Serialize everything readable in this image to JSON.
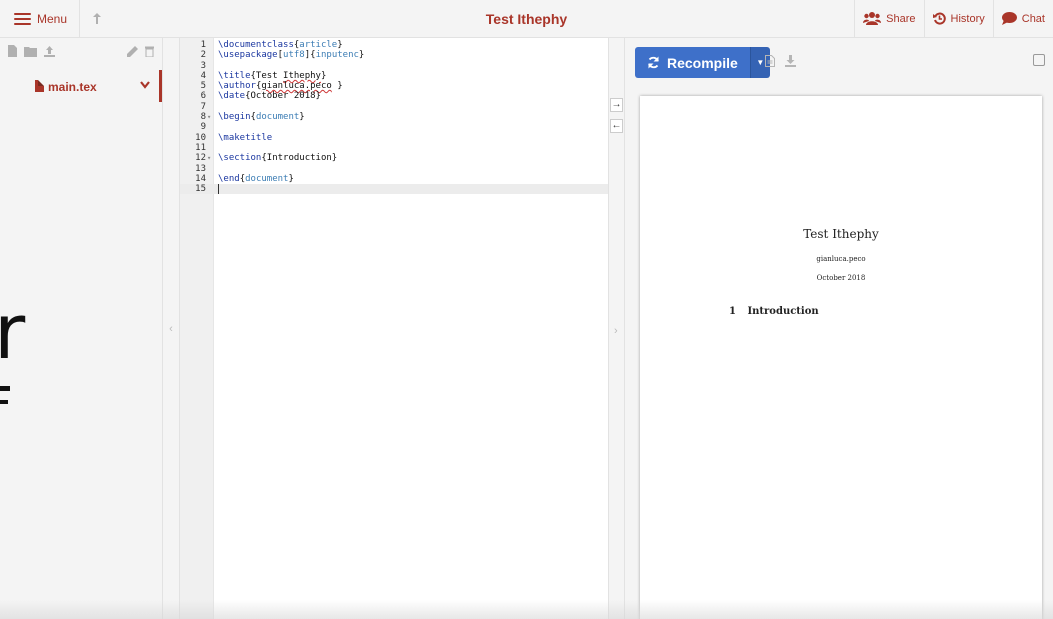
{
  "toolbar": {
    "menu_label": "Menu",
    "title": "Test Ithephy",
    "share_label": "Share",
    "history_label": "History",
    "chat_label": "Chat"
  },
  "colors": {
    "accent": "#a93529",
    "recompile": "#3e70c9"
  },
  "filetree": {
    "files": [
      {
        "name": "main.tex",
        "selected": true
      }
    ]
  },
  "editor": {
    "lines": [
      {
        "n": "1",
        "cmd": "\\documentclass",
        "args": [
          [
            "{",
            ""
          ],
          [
            "article",
            "arg"
          ],
          [
            "}",
            ""
          ]
        ]
      },
      {
        "n": "2",
        "cmd": "\\usepackage",
        "args": [
          [
            "[",
            ""
          ],
          [
            "utf8",
            "arg"
          ],
          [
            "]{",
            ""
          ],
          [
            "inputenc",
            "arg"
          ],
          [
            "}",
            ""
          ]
        ]
      },
      {
        "n": "3"
      },
      {
        "n": "4",
        "cmd": "\\title",
        "args": [
          [
            "{Test ",
            ""
          ],
          [
            "Ithephy",
            "squig"
          ],
          [
            "}",
            ""
          ]
        ]
      },
      {
        "n": "5",
        "cmd": "\\author",
        "args": [
          [
            "{",
            ""
          ],
          [
            "gianluca.peco",
            "squig"
          ],
          [
            " }",
            ""
          ]
        ]
      },
      {
        "n": "6",
        "cmd": "\\date",
        "args": [
          [
            "{October 2018}",
            ""
          ]
        ]
      },
      {
        "n": "7"
      },
      {
        "n": "8",
        "fold": "▾",
        "cmd": "\\begin",
        "args": [
          [
            "{",
            ""
          ],
          [
            "document",
            "arg"
          ],
          [
            "}",
            ""
          ]
        ]
      },
      {
        "n": "9"
      },
      {
        "n": "10",
        "cmd": "\\maketitle"
      },
      {
        "n": "11"
      },
      {
        "n": "12",
        "fold": "▾",
        "cmd": "\\section",
        "args": [
          [
            "{Introduction}",
            ""
          ]
        ]
      },
      {
        "n": "13"
      },
      {
        "n": "14",
        "cmd": "\\end",
        "args": [
          [
            "{",
            ""
          ],
          [
            "document",
            "arg"
          ],
          [
            "}",
            ""
          ]
        ]
      },
      {
        "n": "15",
        "active": true,
        "cursor": true
      }
    ]
  },
  "pdf": {
    "recompile_label": "Recompile",
    "title": "Test Ithephy",
    "author": "gianluca.peco",
    "date": "October 2018",
    "section_number": "1",
    "section_title": "Introduction"
  },
  "overlay": {
    "glyph": "r"
  }
}
